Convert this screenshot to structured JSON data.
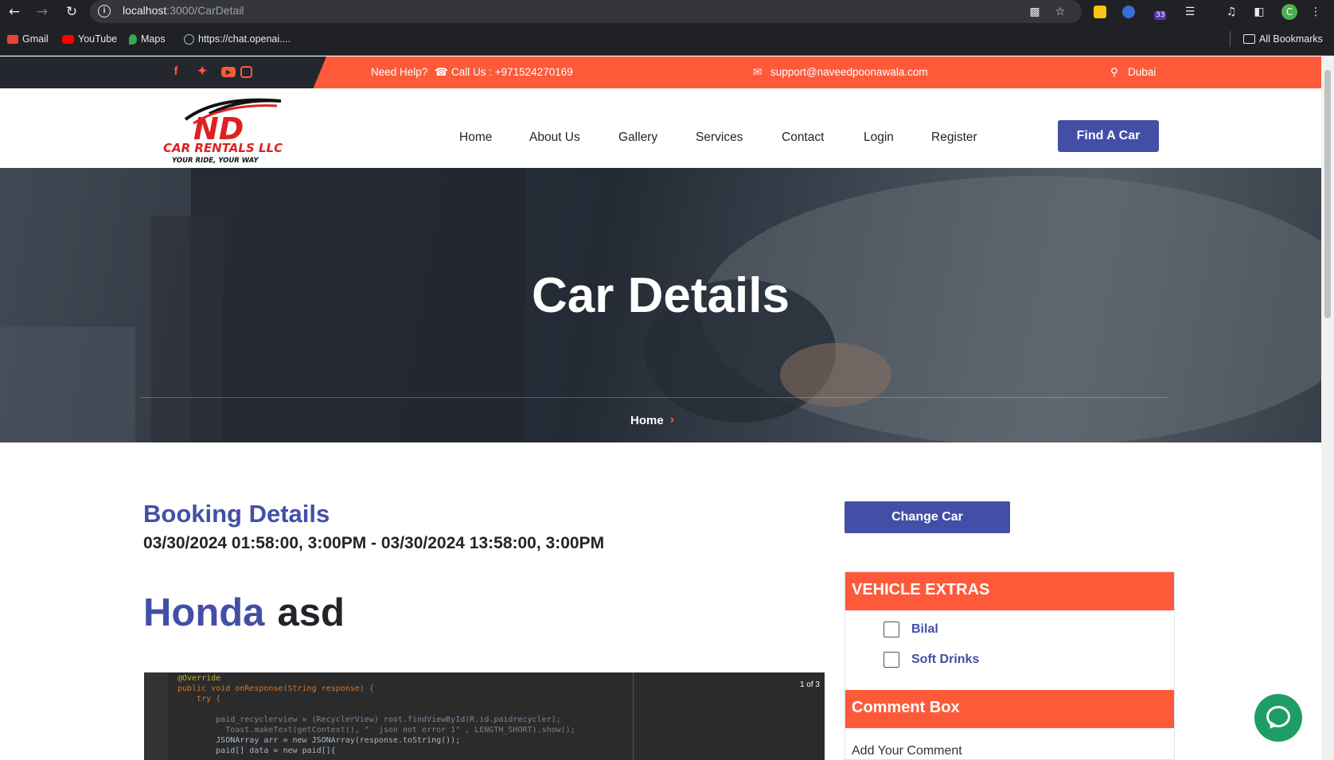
{
  "browser": {
    "url_host": "localhost",
    "url_path": ":3000/CarDetail",
    "bookmarks": [
      "Gmail",
      "YouTube",
      "Maps",
      "https://chat.openai...."
    ],
    "all_bookmarks": "All Bookmarks",
    "extension_badge": "33",
    "profile_initial": "C"
  },
  "topbar": {
    "need_help": "Need Help?",
    "call": "Call Us : +971524270169",
    "email": "support@naveedpoonawala.com",
    "location": "Dubai",
    "social_icons": [
      "facebook-icon",
      "twitter-icon",
      "youtube-icon",
      "instagram-icon"
    ]
  },
  "logo": {
    "mark": "ND",
    "name": "CAR RENTALS LLC",
    "tagline": "YOUR RIDE, YOUR WAY"
  },
  "nav": {
    "items": [
      "Home",
      "About Us",
      "Gallery",
      "Services",
      "Contact",
      "Login",
      "Register"
    ],
    "cta": "Find A Car"
  },
  "hero": {
    "title": "Car Details",
    "breadcrumb": "Home"
  },
  "booking": {
    "title": "Booking Details",
    "dates": "03/30/2024 01:58:00, 3:00PM - 03/30/2024 13:58:00, 3:00PM",
    "brand": "Honda",
    "model": "asd",
    "image_counter": "1 of 3"
  },
  "code_snippet": [
    "@Override",
    "public void onResponse(String response) {",
    "    try {",
    "",
    "        paid_recyclerview = (RecyclerView) root.findViewById(R.id.paidrecycler);",
    "          Toast.makeText(getContext(), \"  json not error 1\" , LENGTH_SHORT).show();",
    "        JSONArray arr = new JSONArray(response.toString());",
    "        paid[] data = new paid[]{"
  ],
  "sidebar": {
    "change_car": "Change Car",
    "extras_title": "VEHICLE EXTRAS",
    "extras": [
      "Bilal",
      "Soft Drinks"
    ],
    "comment_title": "Comment Box",
    "comment_placeholder": "Add Your Comment"
  },
  "colors": {
    "accent": "#fe5a3a",
    "brand": "#434fa6",
    "dark": "#24272e"
  }
}
